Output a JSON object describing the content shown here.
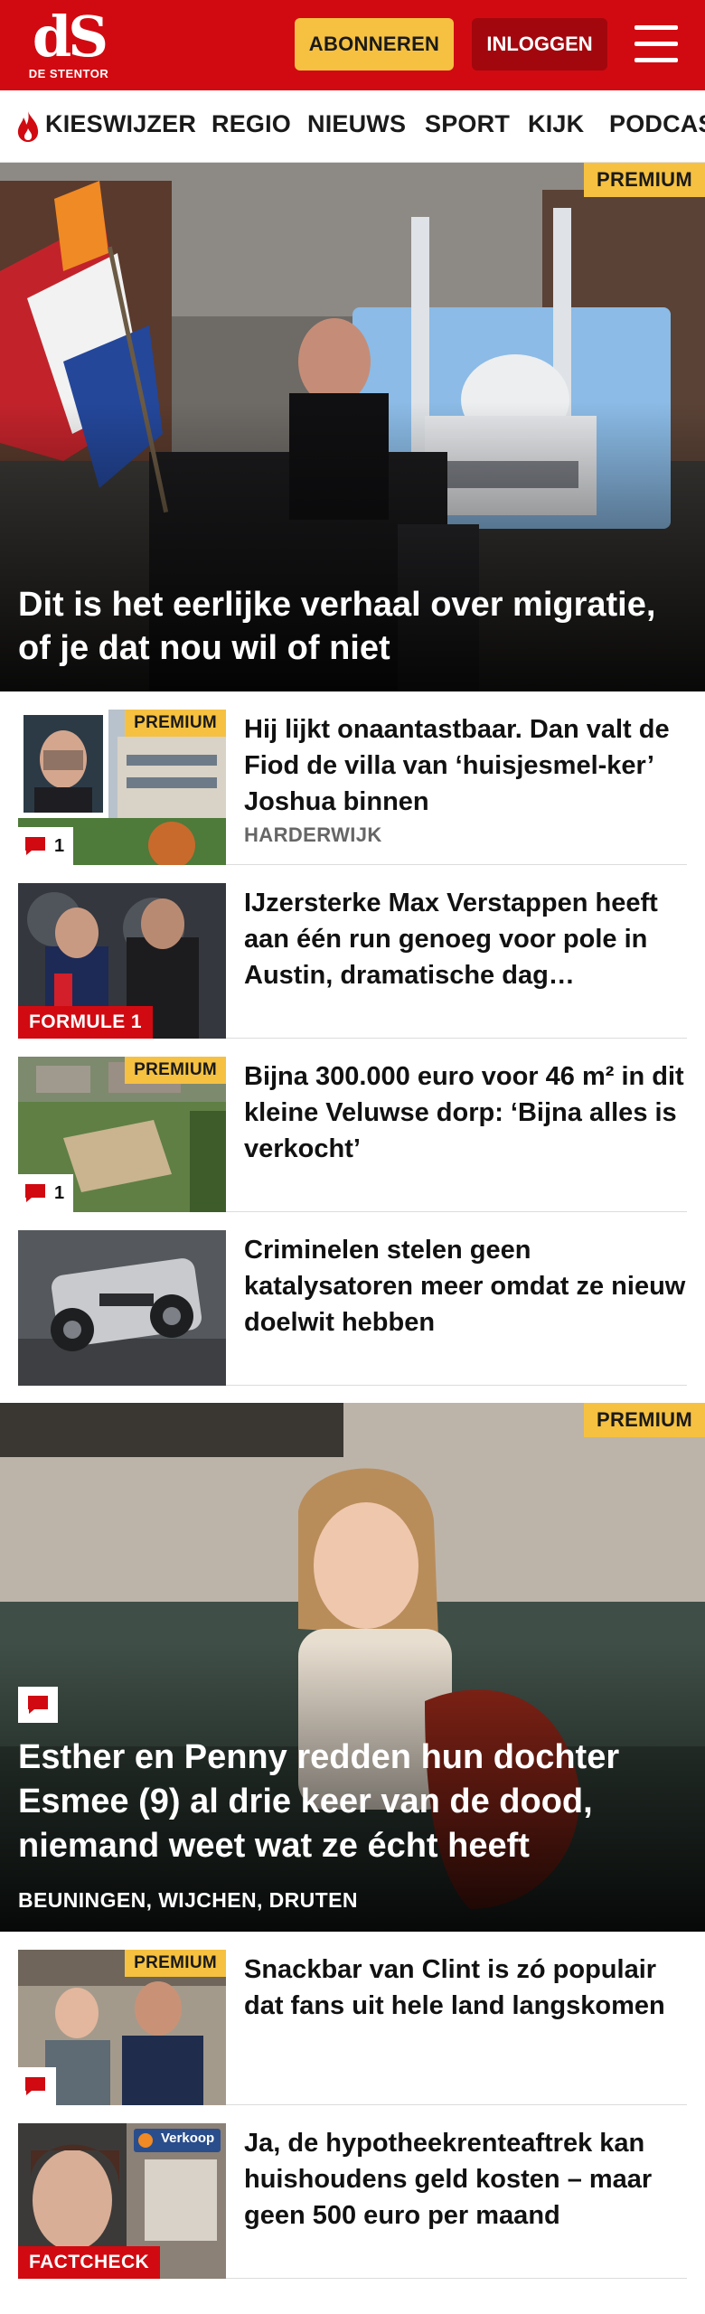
{
  "header": {
    "logo_text": "dS",
    "logo_subtext": "DE STENTOR",
    "subscribe_label": "ABONNEREN",
    "login_label": "INLOGGEN",
    "brand_color": "#d10a11",
    "accent_color": "#f6c141",
    "icons": {
      "menu": "hamburger-menu-icon"
    }
  },
  "nav": {
    "items": [
      {
        "label": "KIESWIJZER",
        "icon": "flame-icon"
      },
      {
        "label": "REGIO"
      },
      {
        "label": "NIEUWS"
      },
      {
        "label": "SPORT"
      },
      {
        "label": "KIJK"
      },
      {
        "label": "PODCAS"
      }
    ]
  },
  "hero": {
    "badge": "PREMIUM",
    "title": "Dit is het eerlijke verhaal over migratie, of je dat nou wil of niet"
  },
  "articles": [
    {
      "badge": "PREMIUM",
      "title": "Hij lijkt onaantastbaar. Dan valt de Fiod de villa van ‘huisjesmel-ker’ Joshua binnen",
      "location": "HARDERWIJK",
      "comments": "1"
    },
    {
      "label": "FORMULE 1",
      "title": "IJzersterke Max Verstappen heeft aan één run genoeg voor pole in Austin, dramatische dag…"
    },
    {
      "badge": "PREMIUM",
      "title": "Bijna 300.000 euro voor 46 m² in dit kleine Veluwse dorp: ‘Bijna alles is verkocht’",
      "comments": "1"
    },
    {
      "title": "Criminelen stelen geen katalysatoren meer omdat ze nieuw doelwit hebben"
    }
  ],
  "hero2": {
    "badge": "PREMIUM",
    "title": "Esther en Penny redden hun dochter Esmee (9) al drie keer van de dood, niemand weet wat ze écht heeft",
    "location": "BEUNINGEN, WIJCHEN, DRUTEN"
  },
  "articles2": [
    {
      "badge": "PREMIUM",
      "title": "Snackbar van Clint is zó populair dat fans uit hele land langskomen"
    },
    {
      "label": "FACTCHECK",
      "sign_text": "Verkoop",
      "title": "Ja, de hypotheekrenteaftrek kan huishoudens geld kosten – maar geen 500 euro per maand"
    }
  ]
}
